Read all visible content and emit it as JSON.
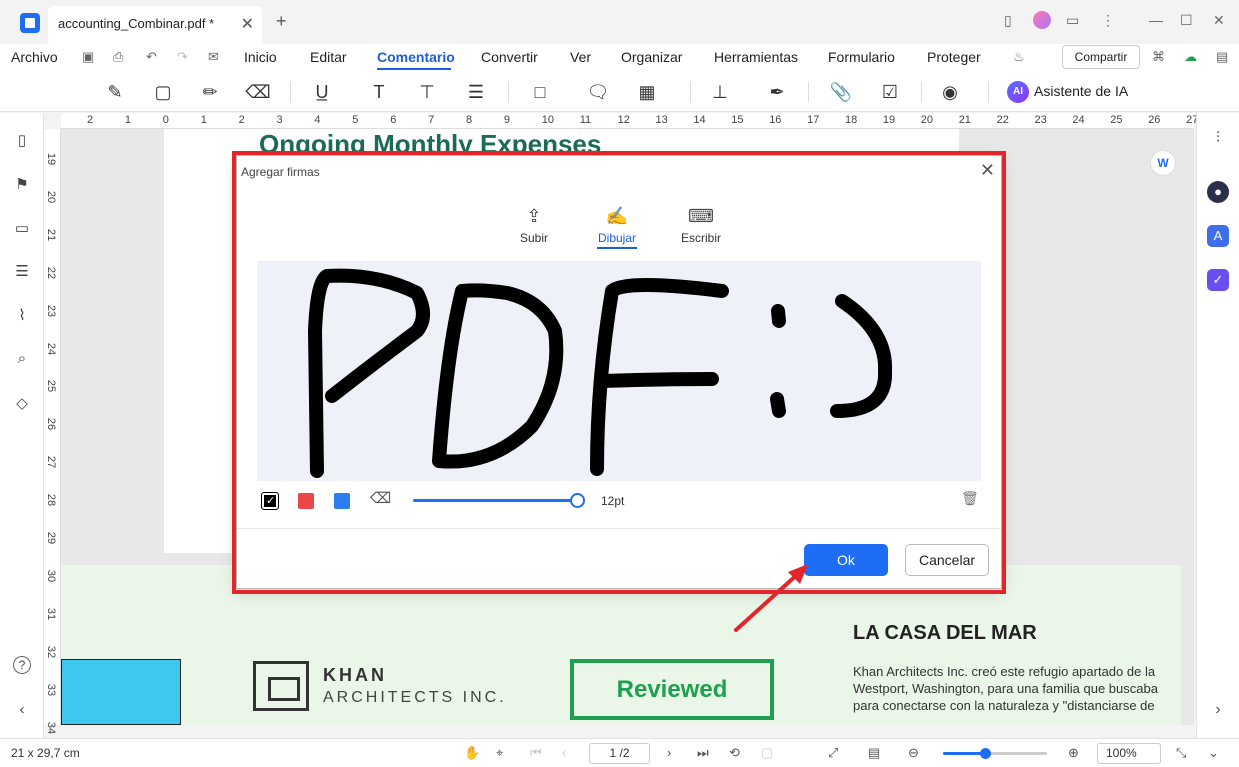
{
  "titlebar": {
    "tab_title": "accounting_Combinar.pdf *",
    "tab_close": "✕",
    "tab_add": "+"
  },
  "menubar": {
    "archivo": "Archivo",
    "items": [
      "Inicio",
      "Editar",
      "Comentario",
      "Convertir",
      "Ver",
      "Organizar",
      "Herramientas",
      "Formulario",
      "Proteger"
    ],
    "active": "Comentario",
    "share_label": "Compartir"
  },
  "toolbar": {
    "ai_badge": "AI",
    "ai_label": "Asistente de IA"
  },
  "rulers": {
    "h_ticks": [
      "2",
      "1",
      "0",
      "1",
      "2",
      "3",
      "4",
      "5",
      "6",
      "7",
      "8",
      "9",
      "10",
      "11",
      "12",
      "13",
      "14",
      "15",
      "16",
      "17",
      "18",
      "19",
      "20",
      "21",
      "22",
      "23",
      "24",
      "25",
      "26",
      "27"
    ],
    "v_ticks": [
      "19",
      "20",
      "21",
      "22",
      "23",
      "24",
      "25",
      "26",
      "27",
      "28",
      "29",
      "30",
      "31",
      "32",
      "33",
      "34"
    ]
  },
  "document": {
    "page_title": "Ongoing Monthly Expenses",
    "khan_name": "KHAN",
    "khan_sub": "ARCHITECTS INC.",
    "reviewed": "Reviewed",
    "casa_title": "LA CASA DEL MAR",
    "casa_text": "Khan Architects Inc. creó este refugio apartado de la\nWestport, Washington, para una familia que buscaba\npara conectarse con la naturaleza y \"distanciarse de"
  },
  "dialog": {
    "title": "Agregar firmas",
    "tabs": [
      "Subir",
      "Dibujar",
      "Escribir"
    ],
    "active_tab": "Dibujar",
    "signature_text": "PDF :)",
    "colors": [
      "#000000",
      "#e84848",
      "#2c7df0"
    ],
    "selected_color": "#000000",
    "pen_size_label": "12pt",
    "pen_size_fraction": 1.0,
    "ok_label": "Ok",
    "cancel_label": "Cancelar"
  },
  "statusbar": {
    "page_size": "21 x 29,7 cm",
    "page_indicator": "1 /2",
    "zoom": "100%",
    "zoom_fraction": 0.4
  },
  "colors": {
    "accent": "#1e6ef5",
    "annotation_red": "#e3242b",
    "reviewed_green": "#1ea050",
    "title_green": "#1b6b57"
  }
}
